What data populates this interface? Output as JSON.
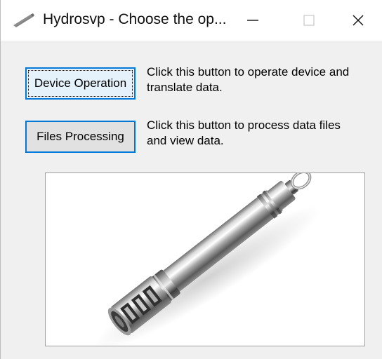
{
  "window": {
    "title": "Hydrosvp - Choose the op...",
    "icon": "probe-pen-icon",
    "controls": {
      "minimize": "minimize-icon",
      "maximize": "maximize-icon",
      "close": "close-icon"
    }
  },
  "actions": [
    {
      "button_label": "Device Operation",
      "description": "Click this button to operate device and\ntranslate data."
    },
    {
      "button_label": "Files Processing",
      "description": "Click this button to process data files\nand view data."
    }
  ],
  "image": {
    "subject": "cylindrical metal sensor probe"
  },
  "colors": {
    "accent": "#0078d7",
    "window_bg": "#f0f0f0",
    "titlebar_bg": "#ffffff"
  }
}
